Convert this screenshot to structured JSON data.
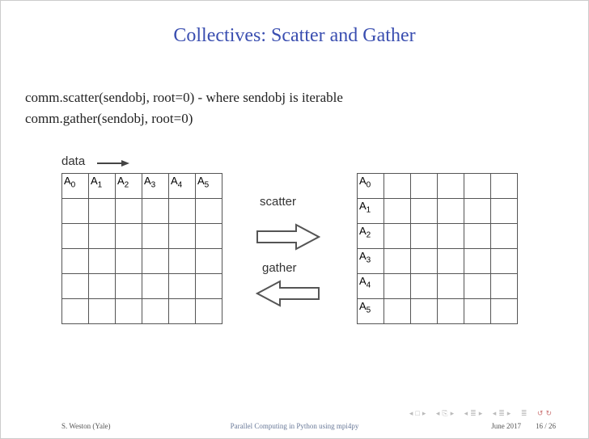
{
  "title": "Collectives: Scatter and Gather",
  "body": {
    "line1": "comm.scatter(sendobj, root=0) - where sendobj is iterable",
    "line2": "comm.gather(sendobj, root=0)"
  },
  "diagram": {
    "data_label": "data",
    "scatter_label": "scatter",
    "gather_label": "gather",
    "cells": [
      "A0",
      "A1",
      "A2",
      "A3",
      "A4",
      "A5"
    ]
  },
  "footer": {
    "author": "S. Weston (Yale)",
    "talk": "Parallel Computing in Python using mpi4py",
    "date": "June 2017",
    "page": "16 / 26"
  }
}
